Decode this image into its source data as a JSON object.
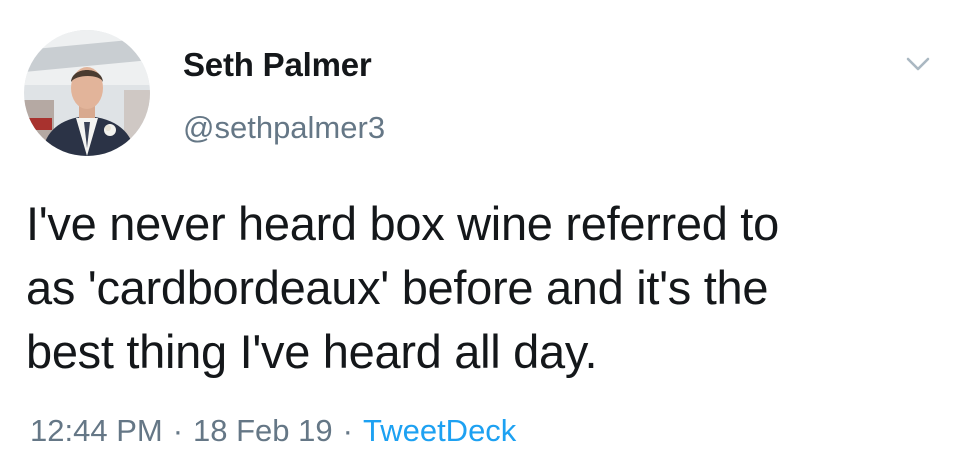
{
  "user": {
    "display_name": "Seth Palmer",
    "handle": "@sethpalmer3",
    "avatar_icon": "profile-photo"
  },
  "tweet": {
    "text_lines": [
      "I've never heard box wine referred to",
      "as 'cardbordeaux' before and it's the",
      "best thing I've heard all day."
    ]
  },
  "meta": {
    "time": "12:44 PM",
    "separator": "·",
    "date": "18 Feb 19",
    "source": "TweetDeck"
  },
  "icons": {
    "menu": "chevron-down-icon"
  },
  "colors": {
    "text": "#14171a",
    "secondary": "#657786",
    "link": "#1da1f2",
    "chevron": "#aab8c2"
  }
}
